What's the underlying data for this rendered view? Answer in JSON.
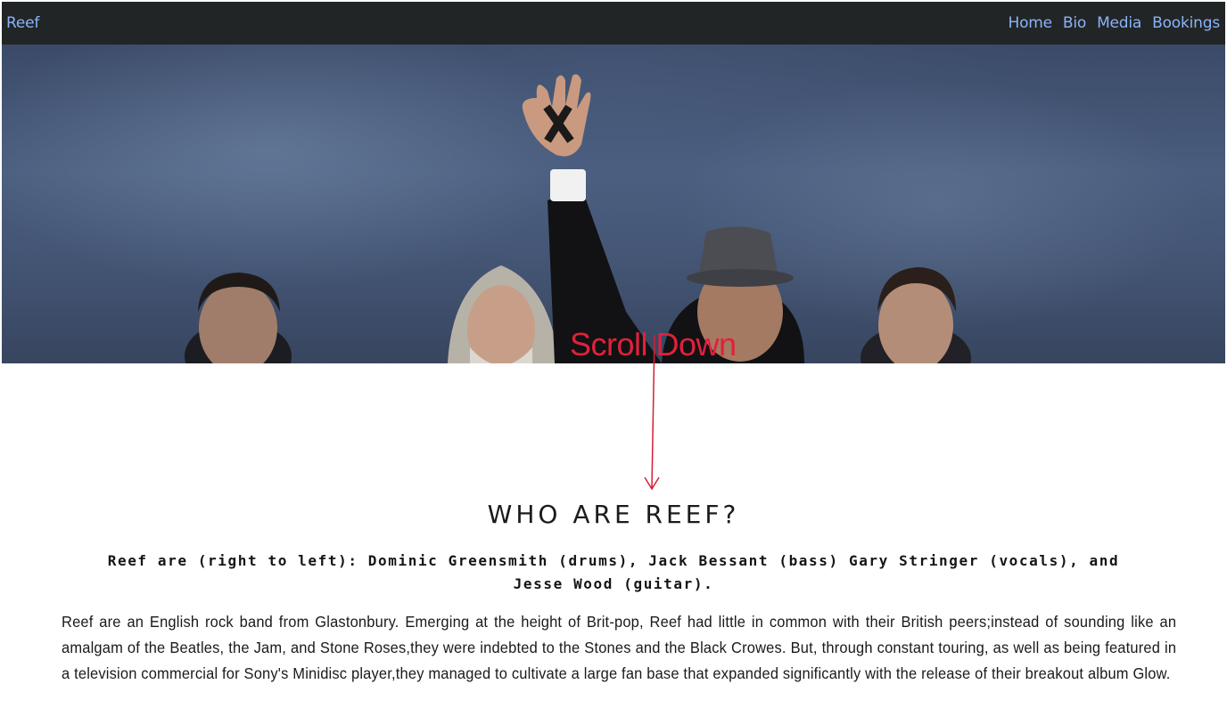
{
  "navbar": {
    "brand": "Reef",
    "links": [
      {
        "label": "Home"
      },
      {
        "label": "Bio"
      },
      {
        "label": "Media"
      },
      {
        "label": "Bookings"
      }
    ]
  },
  "hero": {
    "annotation": "Scroll Down"
  },
  "section": {
    "title": "WHO ARE REEF?",
    "members": "Reef are (right to left): Dominic Greensmith (drums), Jack Bessant (bass) Gary Stringer (vocals), and Jesse Wood (guitar).",
    "bio": "Reef are an English rock band from Glastonbury. Emerging at the height of Brit-pop, Reef had little in common with their British peers;instead of sounding like an amalgam of the Beatles, the Jam, and Stone Roses,they were indebted to the Stones and the Black Crowes. But, through constant touring, as well as being featured in a television commercial for Sony's Minidisc player,they managed to cultivate a large fan base that expanded significantly with the release of their breakout album Glow."
  },
  "colors": {
    "navbar_bg": "#222526",
    "nav_link": "#8ab4f8",
    "annotation": "#e0213b"
  }
}
